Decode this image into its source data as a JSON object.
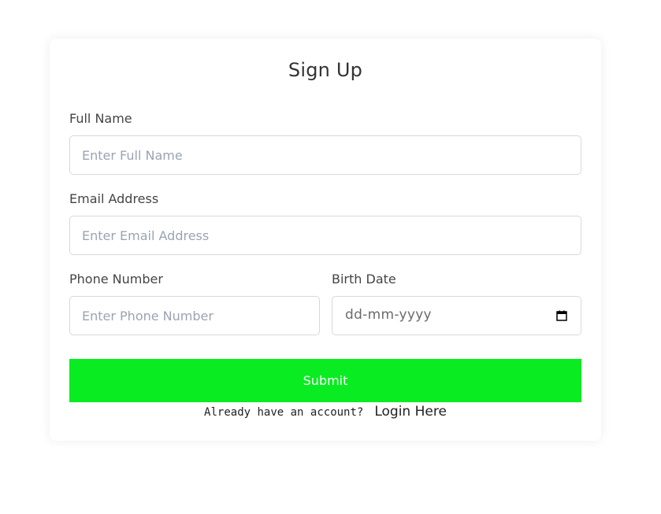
{
  "form": {
    "title": "Sign Up",
    "full_name": {
      "label": "Full Name",
      "placeholder": "Enter Full Name",
      "value": ""
    },
    "email": {
      "label": "Email Address",
      "placeholder": "Enter Email Address",
      "value": ""
    },
    "phone": {
      "label": "Phone Number",
      "placeholder": "Enter Phone Number",
      "value": ""
    },
    "birth_date": {
      "label": "Birth Date",
      "placeholder": "dd-mm-yyyy",
      "icon": "calendar-icon"
    },
    "submit_label": "Submit",
    "login_prompt": "Already have an account?",
    "login_link": "Login Here"
  },
  "colors": {
    "submit_background": "#09ec21",
    "submit_text": "#ffffff",
    "placeholder": "#9aa4b2",
    "field_border": "#d9d9d9"
  }
}
